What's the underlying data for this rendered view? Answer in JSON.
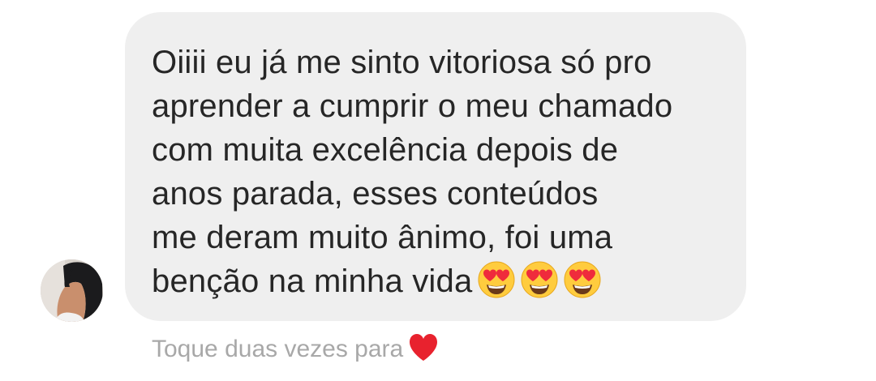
{
  "message": {
    "lines": [
      "Oiiii eu já me sinto vitoriosa só pro",
      "aprender a cumprir o meu chamado",
      "com muita excelência depois de",
      "anos parada, esses conteúdos",
      "me deram muito ânimo, foi uma",
      "benção na minha vida"
    ],
    "emojis": [
      "smiling-face-with-heart-eyes",
      "smiling-face-with-heart-eyes",
      "smiling-face-with-heart-eyes"
    ]
  },
  "reaction_hint": {
    "text": "Toque duas vezes para",
    "icon": "heart-icon",
    "icon_color": "#e8222e"
  },
  "colors": {
    "bubble": "#efefef",
    "text": "#262626",
    "hint": "#a8a8a8"
  }
}
